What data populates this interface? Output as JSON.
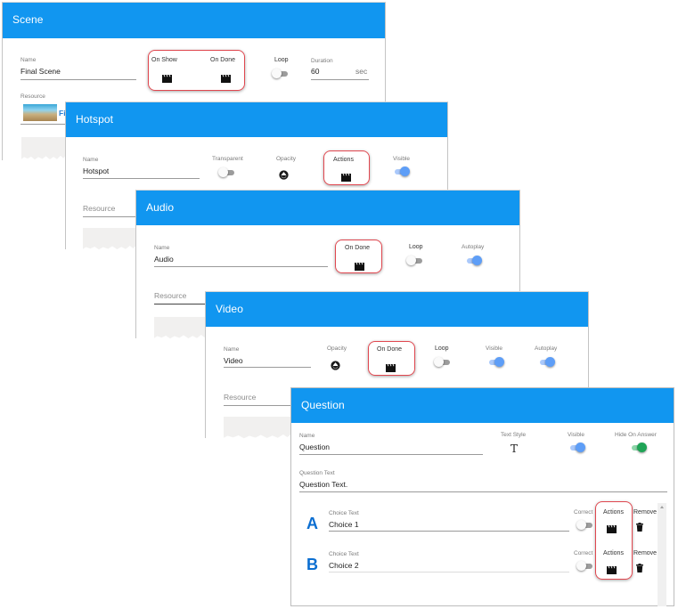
{
  "colors": {
    "header": "#1196f0",
    "highlight": "#e0474f",
    "toggle_on": "#5e9ef7",
    "toggle_green": "#1fa456",
    "choice_letter": "#0b6ed1"
  },
  "panels": {
    "scene": {
      "title": "Scene",
      "name_label": "Name",
      "name_value": "Final Scene",
      "on_show_label": "On Show",
      "on_show_icon": "clapperboard-icon",
      "on_done_label": "On Done",
      "on_done_icon": "clapperboard-icon",
      "loop_label": "Loop",
      "loop_on": false,
      "duration_label": "Duration",
      "duration_value": "60",
      "duration_unit": "sec",
      "resource_label": "Resource",
      "resource_value": "Fi"
    },
    "hotspot": {
      "title": "Hotspot",
      "name_label": "Name",
      "name_value": "Hotspot",
      "transparent_label": "Transparent",
      "transparent_on": false,
      "opacity_label": "Opacity",
      "opacity_icon": "opacity-icon",
      "actions_label": "Actions",
      "actions_icon": "clapperboard-icon",
      "visible_label": "Visible",
      "visible_on": true,
      "resource_placeholder": "Resource"
    },
    "audio": {
      "title": "Audio",
      "name_label": "Name",
      "name_value": "Audio",
      "on_done_label": "On Done",
      "on_done_icon": "clapperboard-icon",
      "loop_label": "Loop",
      "loop_on": false,
      "autoplay_label": "Autoplay",
      "autoplay_on": true,
      "resource_placeholder": "Resource"
    },
    "video": {
      "title": "Video",
      "name_label": "Name",
      "name_value": "Video",
      "opacity_label": "Opacity",
      "opacity_icon": "opacity-icon",
      "on_done_label": "On Done",
      "on_done_icon": "clapperboard-icon",
      "loop_label": "Loop",
      "loop_on": false,
      "visible_label": "Visible",
      "visible_on": true,
      "autoplay_label": "Autoplay",
      "autoplay_on": true,
      "resource_placeholder": "Resource"
    },
    "question": {
      "title": "Question",
      "name_label": "Name",
      "name_value": "Question",
      "text_style_label": "Text Style",
      "text_style_icon": "T",
      "visible_label": "Visible",
      "visible_on": true,
      "hide_on_answer_label": "Hide On Answer",
      "hide_on_answer_on": true,
      "question_text_label": "Question Text",
      "question_text_value": "Question Text.",
      "choices": [
        {
          "letter": "A",
          "label": "Choice Text",
          "value": "Choice 1",
          "correct_label": "Correct",
          "correct_on": false,
          "actions_label": "Actions",
          "remove_label": "Remove"
        },
        {
          "letter": "B",
          "label": "Choice Text",
          "value": "Choice 2",
          "correct_label": "Correct",
          "correct_on": false,
          "actions_label": "Actions",
          "remove_label": "Remove"
        }
      ]
    }
  }
}
